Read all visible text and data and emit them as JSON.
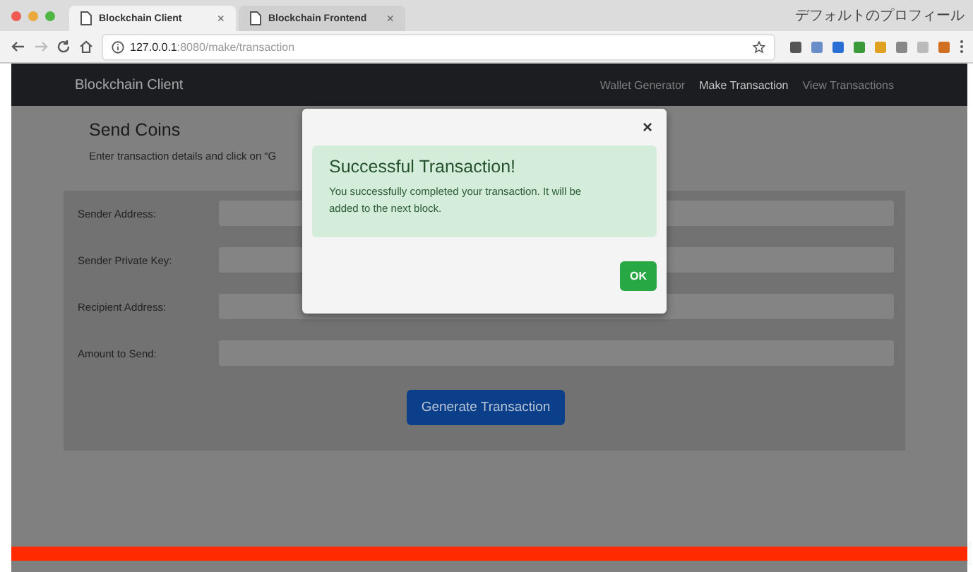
{
  "browser": {
    "tabs": [
      {
        "title": "Blockchain Client",
        "close": "×",
        "selected": true
      },
      {
        "title": "Blockchain Frontend",
        "close": "×",
        "selected": false
      }
    ],
    "profile": "デフォルトのプロフィール",
    "url": {
      "host": "127.0.0.1",
      "path": ":8080/make/transaction"
    }
  },
  "navbar": {
    "brand": "Blockchain Client",
    "links": [
      {
        "label": "Wallet Generator",
        "selected": false
      },
      {
        "label": "Make Transaction",
        "selected": true
      },
      {
        "label": "View Transactions",
        "selected": false
      }
    ]
  },
  "page": {
    "title": "Send Coins",
    "subtitle": "Enter transaction details and click on “G"
  },
  "form": {
    "fields": [
      {
        "label": "Sender Address:"
      },
      {
        "label": "Sender Private Key:"
      },
      {
        "label": "Recipient Address:"
      },
      {
        "label": "Amount to Send:"
      }
    ],
    "submit": "Generate Transaction"
  },
  "modal": {
    "close": "×",
    "heading": "Successful Transaction!",
    "message": "You successfully completed your transaction. It will be added to the next block.",
    "ok": "OK"
  }
}
